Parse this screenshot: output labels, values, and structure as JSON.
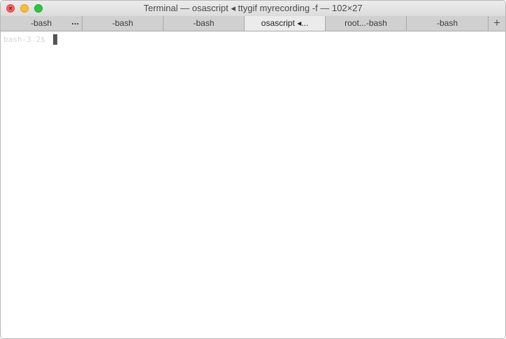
{
  "window": {
    "title": "Terminal — osascript ◂ ttygif myrecording -f — 102×27"
  },
  "window_controls": {
    "close_glyph": "×"
  },
  "tabs": [
    {
      "label": "-bash",
      "more": "..."
    },
    {
      "label": "-bash"
    },
    {
      "label": "-bash"
    },
    {
      "label": "osascript ◂..."
    },
    {
      "label": "root...-bash"
    },
    {
      "label": "-bash"
    }
  ],
  "new_tab_label": "+",
  "terminal": {
    "prompt": "bash-3.2$"
  }
}
